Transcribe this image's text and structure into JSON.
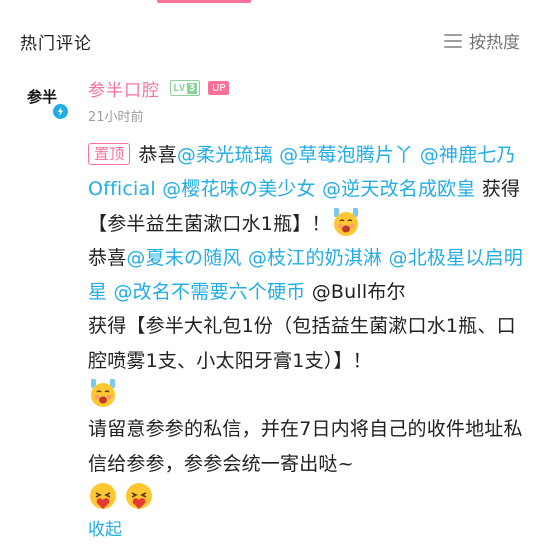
{
  "header": {
    "title": "热门评论",
    "sort_label": "按热度"
  },
  "comment": {
    "avatar_text": "参半",
    "username": "参半口腔",
    "level_prefix": "LV",
    "level_number": "3",
    "up_badge": "UP",
    "time": "21小时前",
    "pin_label": "置顶",
    "collapse_label": "收起",
    "mentions": [
      "@柔光琉璃",
      "@草莓泡腾片丫",
      "@神鹿七乃Official",
      "@樱花味の美少女",
      "@逆天改名成欧皇",
      "@夏末の随风",
      "@枝江的奶淇淋",
      "@北极星以启明星",
      "@改名不需要六个硬币",
      "@Bull布尔"
    ],
    "text": {
      "congrats": "恭喜",
      "win1": " 获得【参半益生菌漱口水1瓶】！",
      "congrats2": "恭喜",
      "win2": "获得【参半大礼包1份（包括益生菌漱口水1瓶、口腔喷雾1支、小太阳牙膏1支）】！",
      "notice": "请留意参参的私信，并在7日内将自己的收件地址私信给参参，参参会统一寄出哒~"
    },
    "emojis": [
      "cheer-emoji",
      "love-emoji"
    ]
  },
  "colors": {
    "accent_pink": "#fb7299",
    "link_blue": "#23ade5",
    "level_green": "#8bd29b"
  }
}
